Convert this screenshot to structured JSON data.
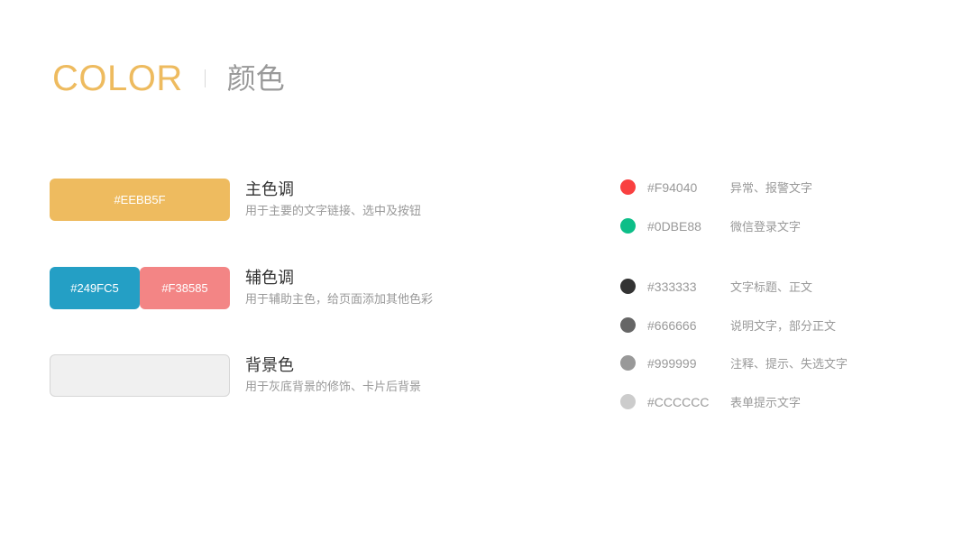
{
  "header": {
    "title_en": "COLOR",
    "title_cn": "颜色"
  },
  "swatches": [
    {
      "title": "主色调",
      "desc": "用于主要的文字链接、选中及按钮",
      "colors": [
        {
          "label": "#EEBB5F",
          "hex": "#EEBB5F"
        }
      ]
    },
    {
      "title": "辅色调",
      "desc": "用于辅助主色，给页面添加其他色彩",
      "colors": [
        {
          "label": "#249FC5",
          "hex": "#249FC5"
        },
        {
          "label": "#F38585",
          "hex": "#F38585"
        }
      ]
    },
    {
      "title": "背景色",
      "desc": "用于灰底背景的修饰、卡片后背景",
      "colors": [
        {
          "label": "",
          "hex": "#F0F0F0"
        }
      ]
    }
  ],
  "text_colors": [
    {
      "hex_label": "#F94040",
      "color": "#F94040",
      "desc": "异常、报警文字"
    },
    {
      "hex_label": "#0DBE88",
      "color": "#0DBE88",
      "desc": "微信登录文字"
    },
    {
      "hex_label": "#333333",
      "color": "#333333",
      "desc": "文字标题、正文"
    },
    {
      "hex_label": "#666666",
      "color": "#666666",
      "desc": "说明文字，部分正文"
    },
    {
      "hex_label": "#999999",
      "color": "#999999",
      "desc": "注释、提示、失选文字"
    },
    {
      "hex_label": "#CCCCCC",
      "color": "#CCCCCC",
      "desc": "表单提示文字"
    }
  ]
}
